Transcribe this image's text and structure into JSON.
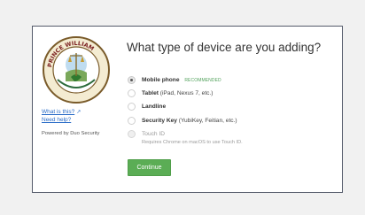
{
  "sidebar": {
    "what_is_this": "What is this?",
    "need_help": "Need help?",
    "powered_by": "Powered by Duo Security",
    "seal_text": "THE SEAL OF PRINCE WILLIAM COUNTY VA"
  },
  "main": {
    "title": "What type of device are you adding?",
    "options": [
      {
        "label": "Mobile phone",
        "detail": "",
        "badge": "RECOMMENDED",
        "state": "selected"
      },
      {
        "label": "Tablet",
        "detail": " (iPad, Nexus 7, etc.)",
        "badge": "",
        "state": "default"
      },
      {
        "label": "Landline",
        "detail": "",
        "badge": "",
        "state": "default"
      },
      {
        "label": "Security Key",
        "detail": " (YubiKey, Feitian, etc.)",
        "badge": "",
        "state": "default"
      },
      {
        "label": "Touch ID",
        "detail": "",
        "badge": "",
        "state": "disabled"
      }
    ],
    "touch_id_hint": "Requires Chrome on macOS to use Touch ID.",
    "continue_label": "Continue"
  },
  "colors": {
    "accent_green": "#5bad55",
    "link_blue": "#2a6cc7",
    "frame_border": "#545a6a"
  }
}
